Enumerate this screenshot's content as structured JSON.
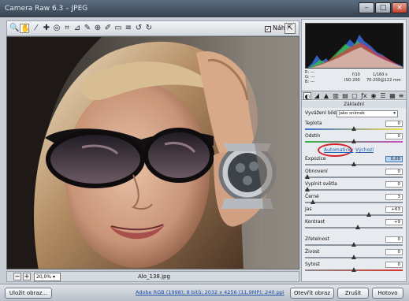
{
  "window": {
    "title": "Camera Raw 6.3 – JPEG",
    "controls": [
      "–",
      "□",
      "×"
    ]
  },
  "toolbar": {
    "tools": [
      {
        "name": "zoom-tool-icon",
        "glyph": "🔍"
      },
      {
        "name": "hand-tool-icon",
        "glyph": "✋"
      },
      {
        "name": "white-balance-tool-icon",
        "glyph": "⁄"
      },
      {
        "name": "color-sampler-tool-icon",
        "glyph": "✚"
      },
      {
        "name": "targeted-adjustment-tool-icon",
        "glyph": "◎"
      },
      {
        "name": "crop-tool-icon",
        "glyph": "⌗"
      },
      {
        "name": "straighten-tool-icon",
        "glyph": "⊿"
      },
      {
        "name": "spot-removal-tool-icon",
        "glyph": "✎"
      },
      {
        "name": "red-eye-tool-icon",
        "glyph": "⊕"
      },
      {
        "name": "adjustment-brush-icon",
        "glyph": "✐"
      },
      {
        "name": "graduated-filter-icon",
        "glyph": "▭"
      },
      {
        "name": "preferences-icon",
        "glyph": "≡"
      },
      {
        "name": "rotate-left-icon",
        "glyph": "↺"
      },
      {
        "name": "rotate-right-icon",
        "glyph": "↻"
      }
    ],
    "preview_label": "Náhled",
    "preview_checked": true,
    "fullscreen_glyph": "⇱"
  },
  "histogram_info": {
    "r": "R: ---",
    "g": "G: ---",
    "b": "B: ---",
    "aperture": "f/10",
    "shutter": "1/160 s",
    "iso": "ISO 200",
    "lens": "70-200@122 mm"
  },
  "panel": {
    "title": "Základní",
    "white_balance_label": "Vyvážení bílé:",
    "white_balance_value": "Jako snímek",
    "auto_label": "Automaticky",
    "default_label": "Výchozí",
    "sliders": [
      {
        "key": "temperature",
        "label": "Teplota",
        "value": "0",
        "pos": 0.5
      },
      {
        "key": "tint",
        "label": "Odstín",
        "value": "0",
        "pos": 0.5
      },
      {
        "key": "exposure",
        "label": "Expozice",
        "value": "0,00",
        "pos": 0.5,
        "highlight": true
      },
      {
        "key": "recovery",
        "label": "Obnovení",
        "value": "0",
        "pos": 0.0
      },
      {
        "key": "fill-light",
        "label": "Vyplnit světla",
        "value": "0",
        "pos": 0.0
      },
      {
        "key": "blacks",
        "label": "Černé",
        "value": "3",
        "pos": 0.06
      },
      {
        "key": "brightness",
        "label": "Jas",
        "value": "+63",
        "pos": 0.66
      },
      {
        "key": "contrast",
        "label": "Kontrast",
        "value": "+9",
        "pos": 0.54
      },
      {
        "key": "clarity",
        "label": "Zřetelnost",
        "value": "0",
        "pos": 0.5
      },
      {
        "key": "vibrance",
        "label": "Živost",
        "value": "0",
        "pos": 0.5
      },
      {
        "key": "saturation",
        "label": "Sytost",
        "value": "0",
        "pos": 0.5
      }
    ]
  },
  "status": {
    "zoom_value": "20,0%",
    "file_name": "Alo_138.jpg"
  },
  "bottom": {
    "save_label": "Uložit obraz...",
    "workflow_label": "Adobe RGB (1998); 8 bitů; 2032 x 4256 (11,9MP); 240 ppi",
    "open_label": "Otevřít obraz",
    "cancel_label": "Zrušit",
    "done_label": "Hotovo"
  },
  "colors": {
    "auto_ring": "#d21f2a",
    "link": "#1d5fb0"
  }
}
